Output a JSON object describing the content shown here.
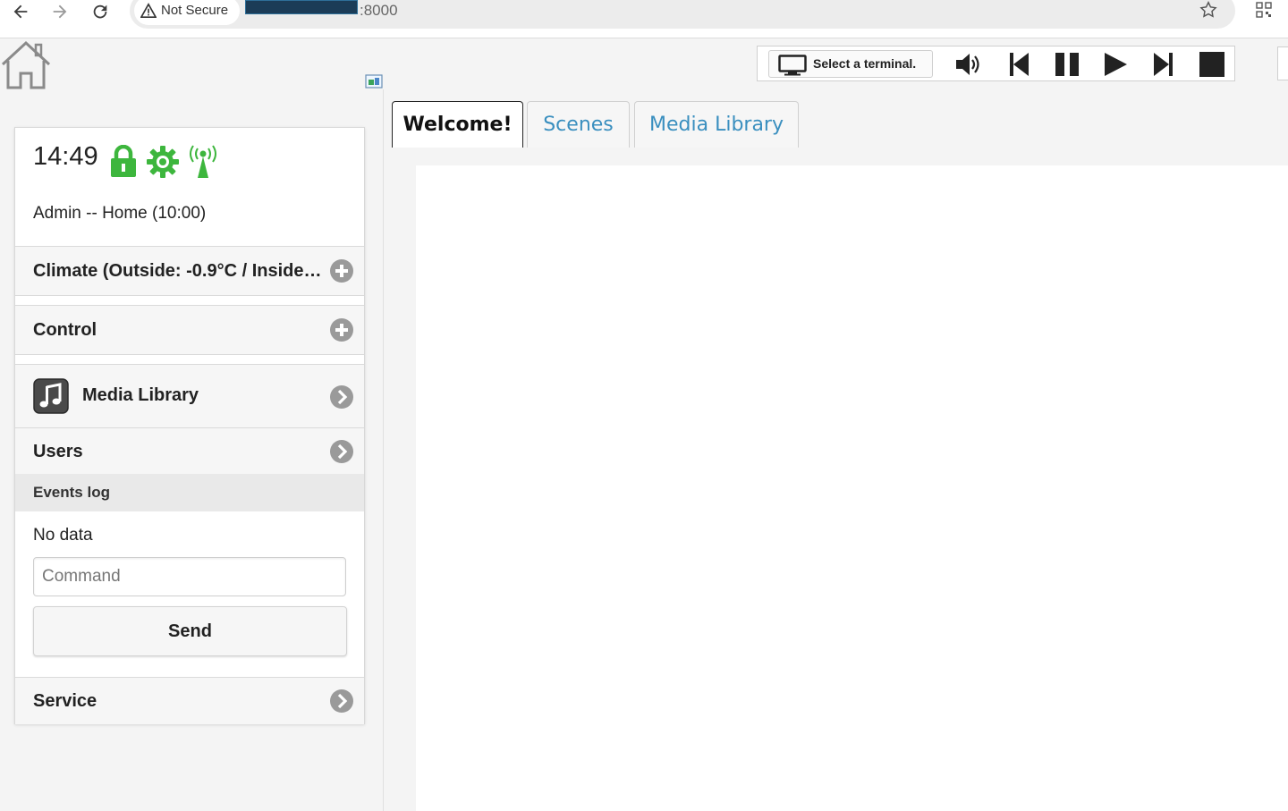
{
  "browser": {
    "security_label": "Not Secure",
    "url_port": ":8000"
  },
  "player": {
    "terminal_label": "Select a terminal.",
    "controls": [
      "volume-icon",
      "previous-icon",
      "pause-icon",
      "play-icon",
      "next-icon",
      "stop-icon"
    ]
  },
  "status": {
    "time": "14:49",
    "user_line": "Admin -- Home (10:00)",
    "icon_color": "#3db63d"
  },
  "sidebar": {
    "climate_label": "Climate (Outside: -0.9°C / Inside…",
    "control_label": "Control",
    "media_label": "Media Library",
    "users_label": "Users",
    "events_label": "Events log",
    "no_data": "No data",
    "command_placeholder": "Command",
    "send_label": "Send",
    "service_label": "Service"
  },
  "tabs": {
    "welcome": "Welcome!",
    "scenes": "Scenes",
    "media": "Media Library"
  },
  "colors": {
    "tab_link": "#3a8fbf",
    "status_green": "#3db63d"
  }
}
